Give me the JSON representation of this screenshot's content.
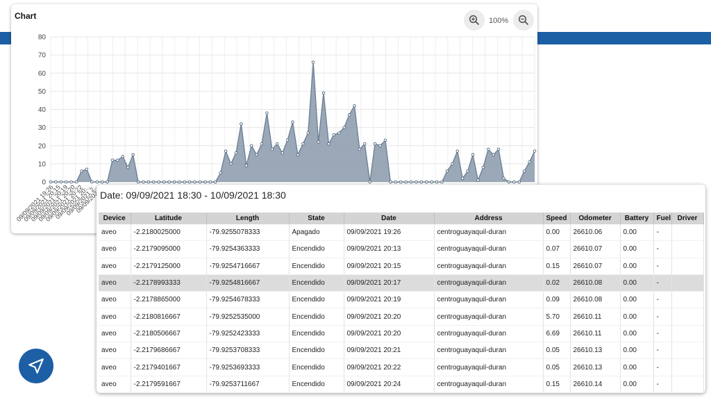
{
  "chart_panel": {
    "title": "Chart",
    "zoom_level": "100%"
  },
  "chart_data": {
    "type": "area",
    "title": "Chart",
    "ylim": [
      0,
      80
    ],
    "yticks": [
      0,
      10,
      20,
      30,
      40,
      50,
      60,
      70,
      80
    ],
    "x_tick_labels": [
      "09/09/2021 19:26",
      "09/09/2021 20:15",
      "09/09/2021 20:19",
      "09/09/2021 20:20",
      "09/09/2021 20:22",
      "09/09/2021 20:..",
      "09/09/2021 2..",
      "09/09/2021 .."
    ],
    "grid": true,
    "fill_color": "#8899ab",
    "line_color": "#6e8296",
    "series": [
      {
        "values": [
          0,
          0,
          0,
          0,
          0,
          0,
          6,
          7,
          0,
          0,
          0,
          0,
          12,
          12,
          14,
          8,
          15,
          0,
          0,
          0,
          0,
          0,
          0,
          0,
          0,
          0,
          0,
          0,
          0,
          0,
          0,
          0,
          0,
          5,
          17,
          10,
          16,
          32,
          9,
          20,
          15,
          21,
          38,
          18,
          21,
          16,
          23,
          33,
          15,
          21,
          27,
          66,
          22,
          49,
          21,
          26,
          27,
          30,
          37,
          42,
          18,
          21,
          0,
          21,
          20,
          23,
          0,
          0,
          0,
          0,
          0,
          0,
          0,
          0,
          0,
          0,
          0,
          6,
          10,
          17,
          2,
          6,
          15,
          1,
          8,
          18,
          15,
          18,
          2,
          0,
          0,
          0,
          6,
          11,
          17
        ]
      }
    ]
  },
  "table_panel": {
    "date_range": "Date: 09/09/2021 18:30 - 10/09/2021 18:30",
    "columns": [
      "Device",
      "Latitude",
      "Length",
      "State",
      "Date",
      "Address",
      "Speed",
      "Odometer",
      "Battery",
      "Fuel",
      "Driver"
    ],
    "rows": [
      [
        "aveo",
        "-2.2180025000",
        "-79.9255078333",
        "Apagado",
        "09/09/2021 19:26",
        "centroguayaquil-duran",
        "0.00",
        "26610.06",
        "0.00",
        "-",
        ""
      ],
      [
        "aveo",
        "-2.2179095000",
        "-79.9254363333",
        "Encendido",
        "09/09/2021 20:13",
        "centroguayaquil-duran",
        "0.07",
        "26610.07",
        "0.00",
        "-",
        ""
      ],
      [
        "aveo",
        "-2.2179125000",
        "-79.9254716667",
        "Encendido",
        "09/09/2021 20:15",
        "centroguayaquil-duran",
        "0.15",
        "26610.07",
        "0.00",
        "-",
        ""
      ],
      [
        "aveo",
        "-2.2178993333",
        "-79.9254816667",
        "Encendido",
        "09/09/2021 20:17",
        "centroguayaquil-duran",
        "0.02",
        "26610.08",
        "0.00",
        "-",
        ""
      ],
      [
        "aveo",
        "-2.2178865000",
        "-79.9254678333",
        "Encendido",
        "09/09/2021 20:19",
        "centroguayaquil-duran",
        "0.09",
        "26610.08",
        "0.00",
        "-",
        ""
      ],
      [
        "aveo",
        "-2.2180816667",
        "-79.9252535000",
        "Encendido",
        "09/09/2021 20:20",
        "centroguayaquil-duran",
        "5.70",
        "26610.11",
        "0.00",
        "-",
        ""
      ],
      [
        "aveo",
        "-2.2180506667",
        "-79.9252423333",
        "Encendido",
        "09/09/2021 20:20",
        "centroguayaquil-duran",
        "6.69",
        "26610.11",
        "0.00",
        "-",
        ""
      ],
      [
        "aveo",
        "-2.2179686667",
        "-79.9253708333",
        "Encendido",
        "09/09/2021 20:21",
        "centroguayaquil-duran",
        "0.05",
        "26610.13",
        "0.00",
        "-",
        ""
      ],
      [
        "aveo",
        "-2.2179401667",
        "-79.9253693333",
        "Encendido",
        "09/09/2021 20:22",
        "centroguayaquil-duran",
        "0.05",
        "26610.13",
        "0.00",
        "-",
        ""
      ],
      [
        "aveo",
        "-2.2179591667",
        "-79.9253711667",
        "Encendido",
        "09/09/2021 20:24",
        "centroguayaquil-duran",
        "0.15",
        "26610.14",
        "0.00",
        "-",
        ""
      ]
    ],
    "selected_row": 3
  },
  "icons": {
    "zoom_in": "zoom-in-icon",
    "zoom_out": "zoom-out-icon",
    "navigation": "navigation-arrow-icon"
  },
  "colors": {
    "brand_blue": "#1c5fa5",
    "header_bg": "#d4d4d4",
    "selected_row_bg": "#dcdcdc"
  }
}
